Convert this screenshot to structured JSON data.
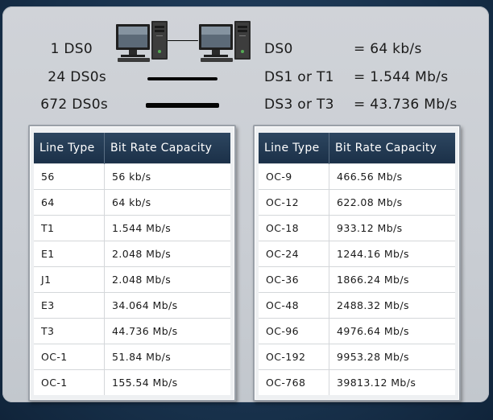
{
  "rows": [
    {
      "left": "1 DS0",
      "line": "DS0",
      "eq": "= 64 kb/s"
    },
    {
      "left": "24 DS0s",
      "line": "DS1 or T1",
      "eq": "= 1.544 Mb/s"
    },
    {
      "left": "672 DS0s",
      "line": "DS3 or T3",
      "eq": "= 43.736 Mb/s"
    }
  ],
  "colors": {
    "background": "#1c3550",
    "panel": "#cbced3",
    "table_header": "#233a52"
  },
  "icons": [
    "computer-icon",
    "computer-icon"
  ],
  "tables": [
    {
      "headers": [
        "Line Type",
        "Bit Rate Capacity"
      ],
      "rows": [
        [
          "56",
          "56 kb/s"
        ],
        [
          "64",
          "64 kb/s"
        ],
        [
          "T1",
          "1.544 Mb/s"
        ],
        [
          "E1",
          "2.048 Mb/s"
        ],
        [
          "J1",
          "2.048 Mb/s"
        ],
        [
          "E3",
          "34.064 Mb/s"
        ],
        [
          "T3",
          "44.736 Mb/s"
        ],
        [
          "OC-1",
          "51.84 Mb/s"
        ],
        [
          "OC-1",
          "155.54 Mb/s"
        ]
      ]
    },
    {
      "headers": [
        "Line Type",
        "Bit Rate Capacity"
      ],
      "rows": [
        [
          "OC-9",
          "466.56 Mb/s"
        ],
        [
          "OC-12",
          "622.08 Mb/s"
        ],
        [
          "OC-18",
          "933.12 Mb/s"
        ],
        [
          "OC-24",
          "1244.16 Mb/s"
        ],
        [
          "OC-36",
          "1866.24 Mb/s"
        ],
        [
          "OC-48",
          "2488.32 Mb/s"
        ],
        [
          "OC-96",
          "4976.64 Mb/s"
        ],
        [
          "OC-192",
          "9953.28 Mb/s"
        ],
        [
          "OC-768",
          "39813.12 Mb/s"
        ]
      ]
    }
  ]
}
